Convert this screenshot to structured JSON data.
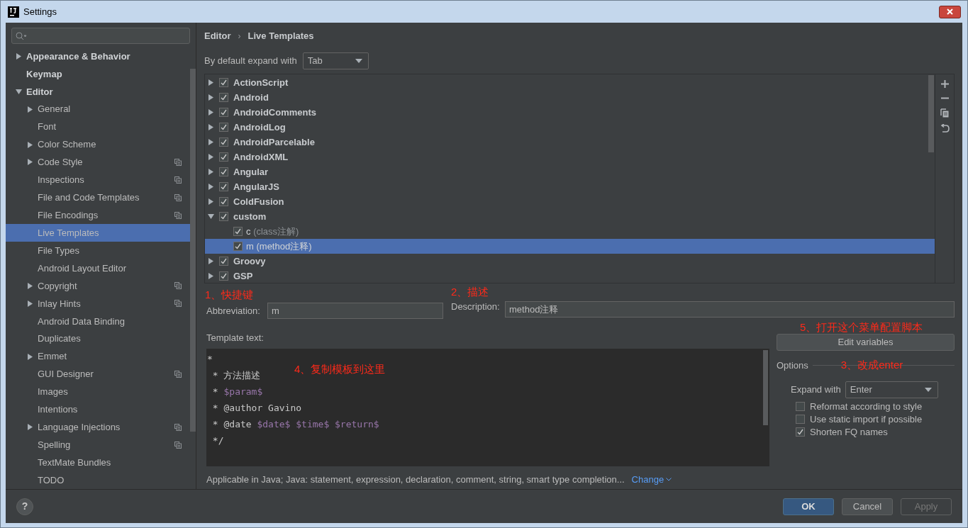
{
  "window": {
    "title": "Settings"
  },
  "sidebar": {
    "items": [
      {
        "label": "Appearance & Behavior",
        "bold": true,
        "expanded": false,
        "selected": false
      },
      {
        "label": "Keymap",
        "bold": true,
        "selected": false
      },
      {
        "label": "Editor",
        "bold": true,
        "expanded": true,
        "selected": false,
        "children": [
          {
            "label": "General",
            "expanded": false,
            "selected": false
          },
          {
            "label": "Font",
            "selected": false
          },
          {
            "label": "Color Scheme",
            "expanded": false,
            "selected": false
          },
          {
            "label": "Code Style",
            "expanded": false,
            "project_scope": true,
            "selected": false
          },
          {
            "label": "Inspections",
            "project_scope": true,
            "selected": false
          },
          {
            "label": "File and Code Templates",
            "project_scope": true,
            "selected": false
          },
          {
            "label": "File Encodings",
            "project_scope": true,
            "selected": false
          },
          {
            "label": "Live Templates",
            "selected": true
          },
          {
            "label": "File Types",
            "selected": false
          },
          {
            "label": "Android Layout Editor",
            "selected": false
          },
          {
            "label": "Copyright",
            "expanded": false,
            "project_scope": true,
            "selected": false
          },
          {
            "label": "Inlay Hints",
            "expanded": false,
            "project_scope": true,
            "selected": false
          },
          {
            "label": "Android Data Binding",
            "selected": false
          },
          {
            "label": "Duplicates",
            "selected": false
          },
          {
            "label": "Emmet",
            "expanded": false,
            "selected": false
          },
          {
            "label": "GUI Designer",
            "project_scope": true,
            "selected": false
          },
          {
            "label": "Images",
            "selected": false
          },
          {
            "label": "Intentions",
            "selected": false
          },
          {
            "label": "Language Injections",
            "expanded": false,
            "project_scope": true,
            "selected": false
          },
          {
            "label": "Spelling",
            "project_scope": true,
            "selected": false
          },
          {
            "label": "TextMate Bundles",
            "selected": false
          },
          {
            "label": "TODO",
            "selected": false
          }
        ]
      }
    ]
  },
  "breadcrumb": [
    "Editor",
    "Live Templates"
  ],
  "breadcrumb_separator": "›",
  "default_expand": {
    "label": "By default expand with",
    "value": "Tab"
  },
  "templates": [
    {
      "label": "ActionScript",
      "checked": true,
      "expanded": false,
      "selected": false
    },
    {
      "label": "Android",
      "checked": true,
      "expanded": false,
      "selected": false
    },
    {
      "label": "AndroidComments",
      "checked": true,
      "expanded": false,
      "selected": false
    },
    {
      "label": "AndroidLog",
      "checked": true,
      "expanded": false,
      "selected": false
    },
    {
      "label": "AndroidParcelable",
      "checked": true,
      "expanded": false,
      "selected": false
    },
    {
      "label": "AndroidXML",
      "checked": true,
      "expanded": false,
      "selected": false
    },
    {
      "label": "Angular",
      "checked": true,
      "expanded": false,
      "selected": false
    },
    {
      "label": "AngularJS",
      "checked": true,
      "expanded": false,
      "selected": false
    },
    {
      "label": "ColdFusion",
      "checked": true,
      "expanded": false,
      "selected": false
    },
    {
      "label": "custom",
      "checked": true,
      "expanded": true,
      "selected": false,
      "children": [
        {
          "abbreviation": "c",
          "description": "(class注解)",
          "checked": true,
          "selected": false
        },
        {
          "abbreviation": "m",
          "description": "(method注释)",
          "checked": true,
          "selected": true
        }
      ]
    },
    {
      "label": "Groovy",
      "checked": true,
      "expanded": false,
      "selected": false
    },
    {
      "label": "GSP",
      "checked": true,
      "expanded": false,
      "selected": false
    }
  ],
  "abbreviation": {
    "annotation": "1、快捷键",
    "label": "Abbreviation:",
    "value": "m"
  },
  "description": {
    "annotation": "2、描述",
    "label": "Description:",
    "value": "method注释"
  },
  "template_text": {
    "label": "Template text:",
    "annotation": "4、复制模板到这里",
    "lines": [
      [
        {
          "kind": "text",
          "text": "*"
        }
      ],
      [
        {
          "kind": "text",
          "text": " * 方法描述"
        }
      ],
      [
        {
          "kind": "text",
          "text": " * "
        },
        {
          "kind": "variable",
          "text": "$param$"
        }
      ],
      [
        {
          "kind": "text",
          "text": " * @author Gavino"
        }
      ],
      [
        {
          "kind": "text",
          "text": " * @date "
        },
        {
          "kind": "variable",
          "text": "$date$"
        },
        {
          "kind": "variable",
          "text": " $time$"
        },
        {
          "kind": "variable",
          "text": " $return$"
        }
      ],
      [
        {
          "kind": "text",
          "text": " */"
        }
      ]
    ]
  },
  "applicable": {
    "text": "Applicable in Java; Java: statement, expression, declaration, comment, string, smart type completion...",
    "link": "Change"
  },
  "edit_variables": {
    "annotation": "5、打开这个菜单配置脚本",
    "label": "Edit variables"
  },
  "options": {
    "title": "Options",
    "annotation": "3、改成enter",
    "expand_with": {
      "label": "Expand with",
      "value": "Enter"
    },
    "checkboxes": [
      {
        "label": "Reformat according to style",
        "checked": false
      },
      {
        "label": "Use static import if possible",
        "checked": false
      },
      {
        "label": "Shorten FQ names",
        "checked": true
      }
    ]
  },
  "buttons": [
    {
      "label": "OK",
      "kind": "primary",
      "disabled": false
    },
    {
      "label": "Cancel",
      "kind": "normal",
      "disabled": false
    },
    {
      "label": "Apply",
      "kind": "normal",
      "disabled": true
    }
  ],
  "help": {
    "label": "?"
  }
}
